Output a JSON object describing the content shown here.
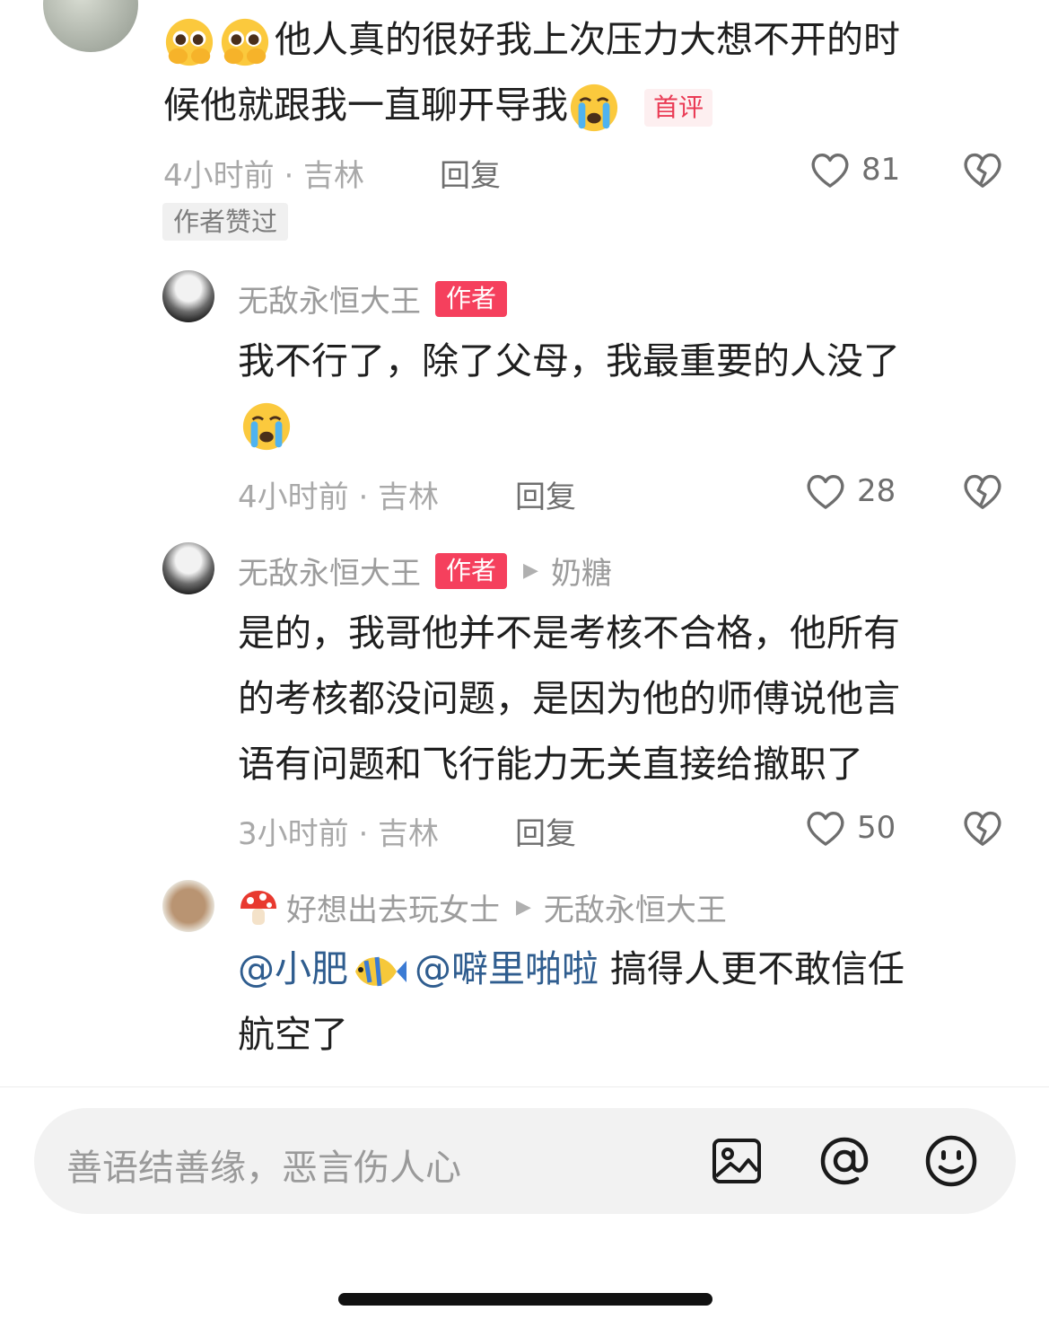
{
  "comments": [
    {
      "emojis_lead": [
        "pleading-face",
        "pleading-face"
      ],
      "text_line1": "他人真的很好我上次压力大想不开的时",
      "text_line2": "候他就跟我一直聊开导我",
      "emoji_tail": "crying-face",
      "badge": "首评",
      "meta": "4小时前 · 吉林",
      "reply": "回复",
      "likes": "81",
      "liked_tag": "作者赞过"
    },
    {
      "name": "无敌永恒大王",
      "badge": "作者",
      "text_line1": "我不行了，除了父母，我最重要的人没了",
      "emoji_line2": "crying-face",
      "meta": "4小时前 · 吉林",
      "reply": "回复",
      "likes": "28"
    },
    {
      "name": "无敌永恒大王",
      "badge": "作者",
      "reply_to": "奶糖",
      "text_line1": "是的，我哥他并不是考核不合格，他所有",
      "text_line2": "的考核都没问题，是因为他的师傅说他言",
      "text_line3": "语有问题和飞行能力无关直接给撤职了",
      "meta": "3小时前 · 吉林",
      "reply": "回复",
      "likes": "50"
    },
    {
      "name_emoji": "mushroom",
      "name": "好想出去玩女士",
      "reply_to": "无敌永恒大王",
      "mention1": "@小肥",
      "mention1_emoji": "tropical-fish",
      "mention2": "@噼里啪啦",
      "text_rest": " 搞得人更不敢信任",
      "text_line2": "航空了"
    }
  ],
  "input": {
    "placeholder": "善语结善缘，恶言伤人心",
    "icons": [
      "image-icon",
      "at-icon",
      "smiley-icon"
    ]
  },
  "colors": {
    "author_badge": "#f5405d",
    "mention": "#2f5d8f",
    "meta_gray": "#a9a9a9"
  }
}
